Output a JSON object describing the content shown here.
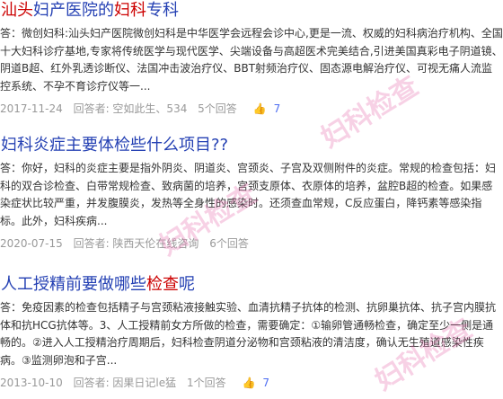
{
  "results": [
    {
      "title": [
        "汕头",
        "妇产医院的",
        "妇科",
        "专科"
      ],
      "abstract": "答：微创妇科:汕头妇产医院微创妇科是中华医学会远程会诊中心,更是一流、权威的妇科病治疗机构、全国十大妇科诊疗基地,专家将传统医学与现代医学、尖端设备与高超医术完美结合,引进美国真彩电子阴道镜、阴道B超、红外乳透诊断仪、法国冲击波治疗仪、BBT射频治疗仪、固态源电解治疗仪、可视无痛人流监控系统、不孕不育诊疗仪等一...",
      "date": "2017-11-24",
      "answerer_label": "回答者: 空如此生、534",
      "answers": "5个回答",
      "likes": "7"
    },
    {
      "title": [
        "妇科炎症主要体检些什么项目??"
      ],
      "abstract": "答：你好，妇科的炎症主要是指外阴炎、阴道炎、宫颈炎、子宫及双侧附件的炎症。常规的检查包括：妇科的双合诊检查、白带常规检查、致病菌的培养，宫颈支原体、衣原体的培养，盆腔B超的检查。如果感染症状比较严重，并发腹膜炎，发热等全身性的感染时。还须查血常规，C反应蛋白，降钙素等感染指标。此外，妇科疾病...",
      "date": "2020-07-15",
      "answerer_label": "回答者: 陕西天伦在线咨询",
      "answers": "6个回答",
      "likes": ""
    },
    {
      "title": [
        "人工授精前要做哪些",
        "检查",
        "呢"
      ],
      "abstract": "答：免疫因素的检查包括精子与宫颈粘液接触实验、血清抗精子抗体的检测、抗卵巢抗体、抗子宫内膜抗体和抗HCG抗体等。3、人工授精前女方所做的检查，需要确定：①输卵管通畅检查，确定至少一侧是通畅的。②进入人工授精治疗周期后，妇科检查阴道分泌物和宫颈粘液的清洁度，确认无生殖道感染性疾病。③监测卵泡和子宫...",
      "date": "2013-10-10",
      "answerer_label": "回答者: 因果日记le猛",
      "answers": "1个回答",
      "likes": "7"
    }
  ],
  "watermark_text": "妇科检查"
}
